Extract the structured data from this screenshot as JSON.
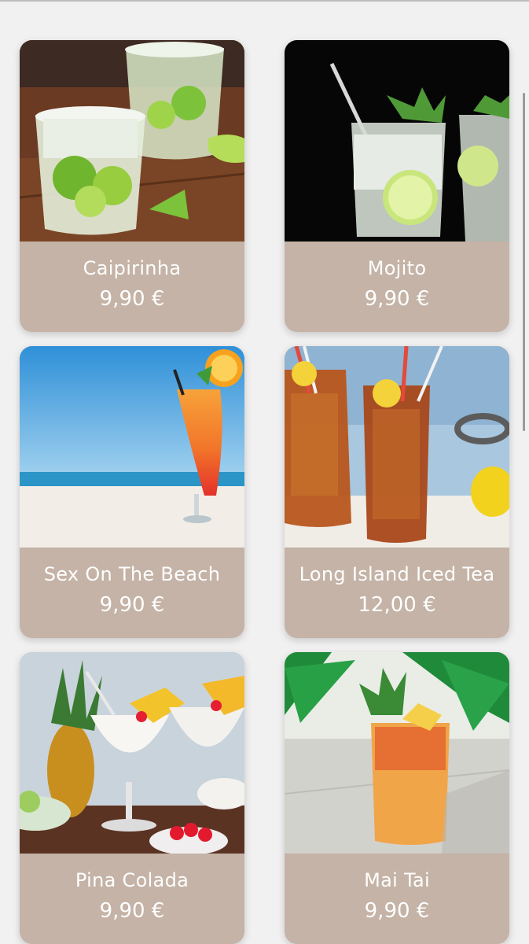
{
  "products": [
    {
      "name": "Caipirinha",
      "price": "9,90 €",
      "photo": "caipirinha-photo"
    },
    {
      "name": "Mojito",
      "price": "9,90 €",
      "photo": "mojito-photo"
    },
    {
      "name": "Sex On The Beach",
      "price": "9,90 €",
      "photo": "sex-on-the-beach-photo"
    },
    {
      "name": "Long Island Iced Tea",
      "price": "12,00 €",
      "photo": "long-island-iced-tea-photo"
    },
    {
      "name": "Pina Colada",
      "price": "9,90 €",
      "photo": "pina-colada-photo"
    },
    {
      "name": "Mai Tai",
      "price": "9,90 €",
      "photo": "mai-tai-photo"
    }
  ],
  "colors": {
    "background": "#f2f1f1",
    "card": "#c4b3a6",
    "card_text": "#ffffff"
  }
}
